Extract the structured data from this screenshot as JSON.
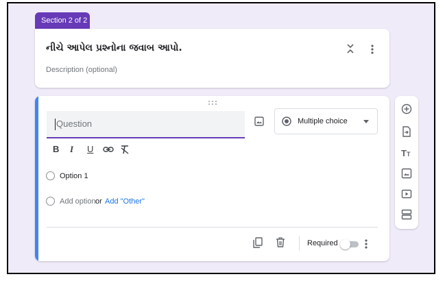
{
  "section": {
    "tab_label": "Section 2 of 2"
  },
  "header": {
    "title": "નીચે આપેલ પ્રશ્નોના જવાબ આપો.",
    "description_placeholder": "Description (optional)"
  },
  "question": {
    "placeholder": "Question",
    "value": "",
    "type_label": "Multiple choice",
    "format_buttons": [
      "B",
      "I",
      "U"
    ],
    "options": [
      {
        "label": "Option 1"
      }
    ],
    "add_option_label": "Add option",
    "or_label": "or",
    "add_other_label": "Add \"Other\"",
    "required_label": "Required",
    "required": false
  },
  "toolbar": {
    "items": [
      "add-question",
      "import-questions",
      "add-title-description",
      "add-image",
      "add-video",
      "add-section"
    ]
  },
  "colors": {
    "accent": "#673ab7",
    "active_border": "#4285f4",
    "link": "#1a73e8",
    "background": "#f0ebf8"
  }
}
